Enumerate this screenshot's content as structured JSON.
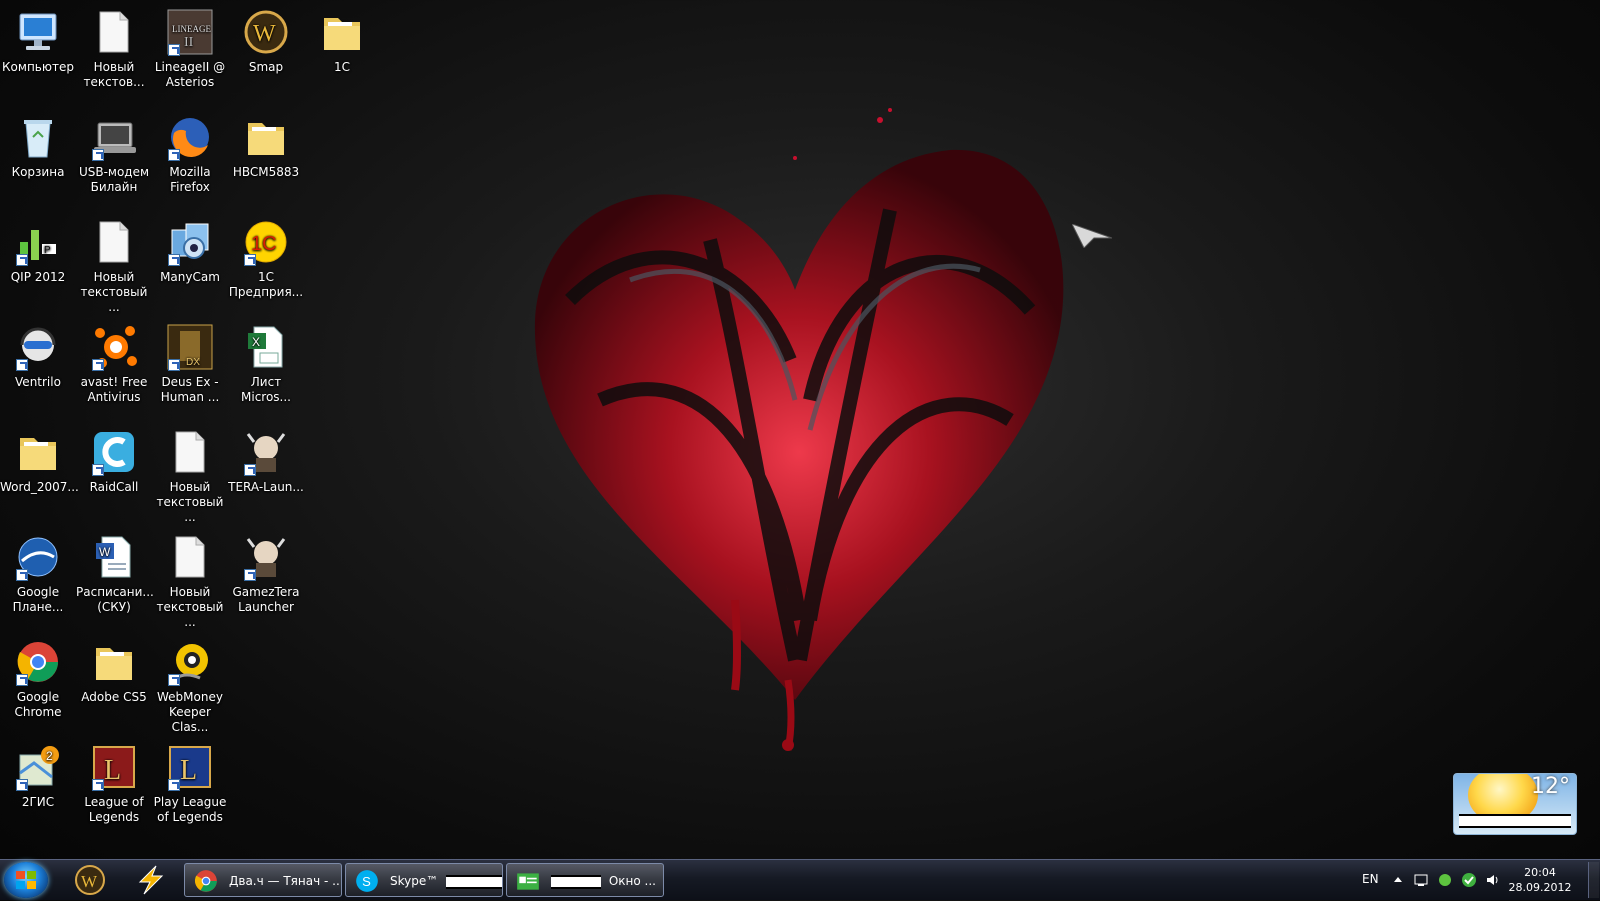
{
  "desktop": {
    "icons": [
      {
        "label": "Компьютер",
        "icon": "computer-icon"
      },
      {
        "label": "Новый\nтекстов...",
        "icon": "text-file-icon"
      },
      {
        "label": "LineageII @\nAsterios",
        "icon": "lineage-icon"
      },
      {
        "label": "Smap",
        "icon": "wow-icon"
      },
      {
        "label": "1C",
        "icon": "folder-icon"
      },
      {
        "label": "Корзина",
        "icon": "recycle-bin-icon"
      },
      {
        "label": "USB-модем\nБилайн",
        "icon": "usb-modem-icon"
      },
      {
        "label": "Mozilla\nFirefox",
        "icon": "firefox-icon"
      },
      {
        "label": "HBCM5883",
        "icon": "folder-icon"
      },
      {
        "label": "QIP 2012",
        "icon": "qip-icon"
      },
      {
        "label": "Новый\nтекстовый ...",
        "icon": "text-file-icon"
      },
      {
        "label": "ManyCam",
        "icon": "manycam-icon"
      },
      {
        "label": "1C\nПредприя...",
        "icon": "1c-icon"
      },
      {
        "label": "Ventrilo",
        "icon": "ventrilo-icon"
      },
      {
        "label": "avast! Free\nAntivirus",
        "icon": "avast-icon"
      },
      {
        "label": "Deus Ex -\nHuman ...",
        "icon": "deus-ex-icon"
      },
      {
        "label": "Лист\nMicros...",
        "icon": "excel-icon"
      },
      {
        "label": "Word_2007...",
        "icon": "folder-icon"
      },
      {
        "label": "RaidCall",
        "icon": "raidcall-icon"
      },
      {
        "label": "Новый\nтекстовый ...",
        "icon": "text-file-icon"
      },
      {
        "label": "TERA-Laun...",
        "icon": "tera-icon"
      },
      {
        "label": "Google\nПлане...",
        "icon": "google-earth-icon"
      },
      {
        "label": "Расписани...\n(СКУ)",
        "icon": "word-doc-icon"
      },
      {
        "label": "Новый\nтекстовый ...",
        "icon": "text-file-icon"
      },
      {
        "label": "GamezTera\nLauncher",
        "icon": "tera-icon"
      },
      {
        "label": "Google\nChrome",
        "icon": "chrome-icon"
      },
      {
        "label": "Adobe CS5",
        "icon": "folder-icon"
      },
      {
        "label": "WebMoney\nKeeper Clas...",
        "icon": "webmoney-icon"
      },
      {
        "label": "2ГИС",
        "icon": "2gis-icon"
      },
      {
        "label": "League of\nLegends",
        "icon": "lol-icon"
      },
      {
        "label": "Play League\nof Legends",
        "icon": "lol-play-icon"
      }
    ]
  },
  "weather": {
    "temp": "12°"
  },
  "taskbar": {
    "tasks": [
      {
        "label": "Два.ч — Тянач - ...",
        "icon": "chrome-icon"
      },
      {
        "label": "Skype™",
        "icon": "skype-icon"
      },
      {
        "label": "Окно ...",
        "icon": "contact-card-icon"
      }
    ],
    "lang": "EN",
    "time": "20:04",
    "date": "28.09.2012"
  },
  "colors": {
    "heart_red": "#c8102e",
    "taskbar": "#161a24"
  }
}
